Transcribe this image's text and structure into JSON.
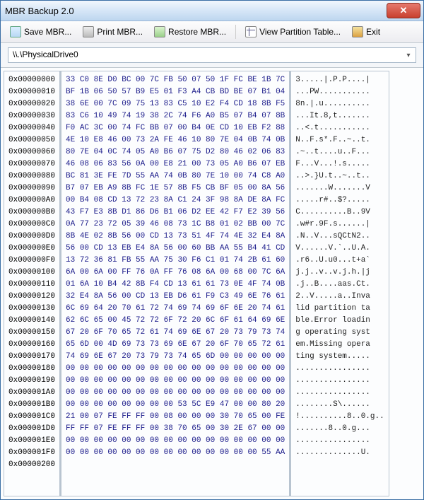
{
  "window": {
    "title": "MBR Backup 2.0"
  },
  "toolbar": {
    "save": "Save MBR...",
    "print": "Print MBR...",
    "restore": "Restore MBR...",
    "table": "View Partition Table...",
    "exit": "Exit"
  },
  "drive": {
    "selected": "\\\\.\\PhysicalDrive0"
  },
  "hex": {
    "rows": [
      {
        "offset": "0x00000000",
        "bytes": "33 C0 8E D0 BC 00 7C FB 50 07 50 1F FC BE 1B 7C",
        "ascii": "3.....|.P.P....|"
      },
      {
        "offset": "0x00000010",
        "bytes": "BF 1B 06 50 57 B9 E5 01 F3 A4 CB BD BE 07 B1 04",
        "ascii": "...PW..........."
      },
      {
        "offset": "0x00000020",
        "bytes": "38 6E 00 7C 09 75 13 83 C5 10 E2 F4 CD 18 8B F5",
        "ascii": "8n.|.u.........."
      },
      {
        "offset": "0x00000030",
        "bytes": "83 C6 10 49 74 19 38 2C 74 F6 A0 B5 07 B4 07 8B",
        "ascii": "...It.8,t......."
      },
      {
        "offset": "0x00000040",
        "bytes": "F0 AC 3C 00 74 FC BB 07 00 B4 0E CD 10 EB F2 88",
        "ascii": "..<.t..........."
      },
      {
        "offset": "0x00000050",
        "bytes": "4E 10 E8 46 00 73 2A FE 46 10 80 7E 04 0B 74 0B",
        "ascii": "N..F.s*.F..~..t."
      },
      {
        "offset": "0x00000060",
        "bytes": "80 7E 04 0C 74 05 A0 B6 07 75 D2 80 46 02 06 83",
        "ascii": ".~..t....u..F..."
      },
      {
        "offset": "0x00000070",
        "bytes": "46 08 06 83 56 0A 00 E8 21 00 73 05 A0 B6 07 EB",
        "ascii": "F...V...!.s....."
      },
      {
        "offset": "0x00000080",
        "bytes": "BC 81 3E FE 7D 55 AA 74 0B 80 7E 10 00 74 C8 A0",
        "ascii": "..>.}U.t..~..t.."
      },
      {
        "offset": "0x00000090",
        "bytes": "B7 07 EB A9 8B FC 1E 57 8B F5 CB BF 05 00 8A 56",
        "ascii": ".......W.......V"
      },
      {
        "offset": "0x000000A0",
        "bytes": "00 B4 08 CD 13 72 23 8A C1 24 3F 98 8A DE 8A FC",
        "ascii": ".....r#..$?....."
      },
      {
        "offset": "0x000000B0",
        "bytes": "43 F7 E3 8B D1 86 D6 B1 06 D2 EE 42 F7 E2 39 56",
        "ascii": "C..........B..9V"
      },
      {
        "offset": "0x000000C0",
        "bytes": "0A 77 23 72 05 39 46 08 73 1C B8 01 02 BB 00 7C",
        "ascii": ".w#r.9F.s......|"
      },
      {
        "offset": "0x000000D0",
        "bytes": "8B 4E 02 8B 56 00 CD 13 73 51 4F 74 4E 32 E4 8A",
        "ascii": ".N..V...sQCtN2.."
      },
      {
        "offset": "0x000000E0",
        "bytes": "56 00 CD 13 EB E4 8A 56 00 60 BB AA 55 B4 41 CD",
        "ascii": "V......V.`..U.A."
      },
      {
        "offset": "0x000000F0",
        "bytes": "13 72 36 81 FB 55 AA 75 30 F6 C1 01 74 2B 61 60",
        "ascii": ".r6..U.u0...t+a`"
      },
      {
        "offset": "0x00000100",
        "bytes": "6A 00 6A 00 FF 76 0A FF 76 08 6A 00 68 00 7C 6A",
        "ascii": "j.j..v..v.j.h.|j"
      },
      {
        "offset": "0x00000110",
        "bytes": "01 6A 10 B4 42 8B F4 CD 13 61 61 73 0E 4F 74 0B",
        "ascii": ".j..B....aas.Ct."
      },
      {
        "offset": "0x00000120",
        "bytes": "32 E4 8A 56 00 CD 13 EB D6 61 F9 C3 49 6E 76 61",
        "ascii": "2..V.....a..Inva"
      },
      {
        "offset": "0x00000130",
        "bytes": "6C 69 64 20 70 61 72 74 69 74 69 6F 6E 20 74 61",
        "ascii": "lid partition ta"
      },
      {
        "offset": "0x00000140",
        "bytes": "62 6C 65 00 45 72 72 6F 72 20 6C 6F 61 64 69 6E",
        "ascii": "ble.Error loadin"
      },
      {
        "offset": "0x00000150",
        "bytes": "67 20 6F 70 65 72 61 74 69 6E 67 20 73 79 73 74",
        "ascii": "g operating syst"
      },
      {
        "offset": "0x00000160",
        "bytes": "65 6D 00 4D 69 73 73 69 6E 67 20 6F 70 65 72 61",
        "ascii": "em.Missing opera"
      },
      {
        "offset": "0x00000170",
        "bytes": "74 69 6E 67 20 73 79 73 74 65 6D 00 00 00 00 00",
        "ascii": "ting system....."
      },
      {
        "offset": "0x00000180",
        "bytes": "00 00 00 00 00 00 00 00 00 00 00 00 00 00 00 00",
        "ascii": "................"
      },
      {
        "offset": "0x00000190",
        "bytes": "00 00 00 00 00 00 00 00 00 00 00 00 00 00 00 00",
        "ascii": "................"
      },
      {
        "offset": "0x000001A0",
        "bytes": "00 00 00 00 00 00 00 00 00 00 00 00 00 00 00 00",
        "ascii": "................"
      },
      {
        "offset": "0x000001B0",
        "bytes": "00 00 00 00 00 00 00 00 53 5C E9 47 00 00 80 20",
        "ascii": "........S\\......"
      },
      {
        "offset": "0x000001C0",
        "bytes": "21 00 07 FE FF FF 00 08 00 00 00 30 70 65 00 FE",
        "ascii": "!..........8..0.g.."
      },
      {
        "offset": "0x000001D0",
        "bytes": "FF FF 07 FE FF FF 00 38 70 65 00 30 2E 67 00 00",
        "ascii": ".......8..0.g..."
      },
      {
        "offset": "0x000001E0",
        "bytes": "00 00 00 00 00 00 00 00 00 00 00 00 00 00 00 00",
        "ascii": "................"
      },
      {
        "offset": "0x000001F0",
        "bytes": "00 00 00 00 00 00 00 00 00 00 00 00 00 00 55 AA",
        "ascii": "..............U."
      },
      {
        "offset": "0x00000200",
        "bytes": "",
        "ascii": ""
      }
    ]
  }
}
